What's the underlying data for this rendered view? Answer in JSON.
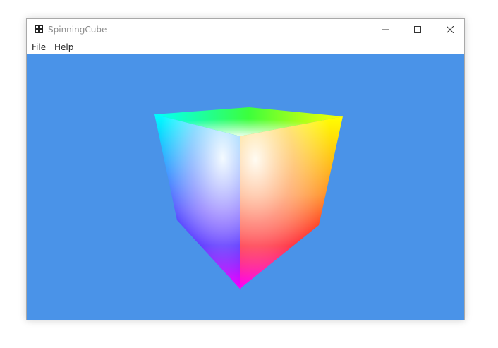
{
  "window": {
    "title": "SpinningCube",
    "app_icon": "app-window-icon",
    "controls": {
      "minimize_icon": "minimize-icon",
      "maximize_icon": "maximize-icon",
      "close_icon": "close-icon"
    }
  },
  "menu": {
    "items": [
      {
        "label": "File"
      },
      {
        "label": "Help"
      }
    ]
  },
  "viewport": {
    "background_color": "#4a93e8",
    "content": "spinning-rgb-cube"
  }
}
